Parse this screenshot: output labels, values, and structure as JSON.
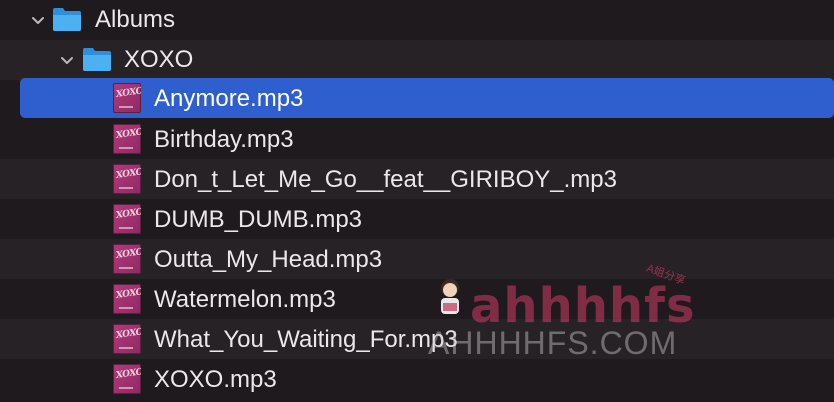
{
  "tree": {
    "root": {
      "label": "Albums",
      "expanded": true
    },
    "folder": {
      "label": "XOXO",
      "expanded": true
    },
    "files": [
      {
        "name": "Anymore.mp3",
        "selected": true
      },
      {
        "name": "Birthday.mp3"
      },
      {
        "name": "Don_t_Let_Me_Go__feat__GIRIBOY_.mp3"
      },
      {
        "name": "DUMB_DUMB.mp3"
      },
      {
        "name": "Outta_My_Head.mp3"
      },
      {
        "name": "Watermelon.mp3"
      },
      {
        "name": "What_You_Waiting_For.mp3"
      },
      {
        "name": "XOXO.mp3"
      }
    ],
    "thumb_text": "XOXO"
  },
  "watermark": {
    "brand": "ahhhhfs",
    "domain": "AHHHHFS.COM",
    "small": "A姐分享"
  },
  "colors": {
    "selection": "#2f5fcf",
    "folder": "#3ea7f0",
    "thumb": "#b33a7a",
    "background": "#1e1a1d"
  }
}
